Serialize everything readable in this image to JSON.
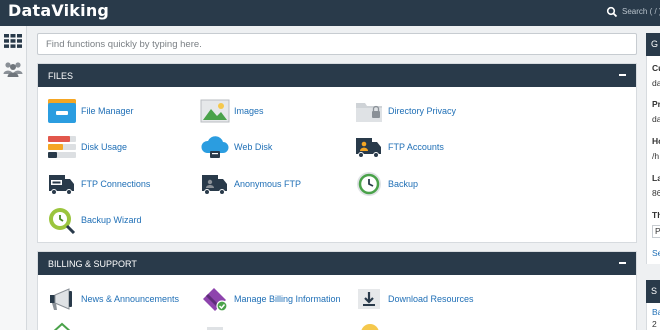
{
  "brand": "DataViking",
  "topbar": {
    "search_text": "Search ( / )"
  },
  "search": {
    "placeholder": "Find functions quickly by typing here."
  },
  "files": {
    "title": "FILES",
    "items": [
      {
        "label": "File Manager",
        "icon": "file-manager-icon"
      },
      {
        "label": "Images",
        "icon": "images-icon"
      },
      {
        "label": "Directory Privacy",
        "icon": "directory-privacy-icon"
      },
      {
        "label": "Disk Usage",
        "icon": "disk-usage-icon"
      },
      {
        "label": "Web Disk",
        "icon": "web-disk-icon"
      },
      {
        "label": "FTP Accounts",
        "icon": "ftp-accounts-icon"
      },
      {
        "label": "FTP Connections",
        "icon": "ftp-connections-icon"
      },
      {
        "label": "Anonymous FTP",
        "icon": "anonymous-ftp-icon"
      },
      {
        "label": "Backup",
        "icon": "backup-icon"
      },
      {
        "label": "Backup Wizard",
        "icon": "backup-wizard-icon"
      }
    ]
  },
  "billing": {
    "title": "BILLING & SUPPORT",
    "items": [
      {
        "label": "News & Announcements",
        "icon": "megaphone-icon"
      },
      {
        "label": "Manage Billing Information",
        "icon": "billing-card-icon"
      },
      {
        "label": "Download Resources",
        "icon": "download-icon"
      }
    ]
  },
  "right": {
    "head1": "G",
    "labels": [
      "Cu",
      "da",
      "Pr",
      "da",
      "Ho",
      "/h",
      "La",
      "86",
      "Th",
      "P",
      "Se"
    ],
    "head2": "S",
    "bottom": [
      "Ba",
      "2"
    ]
  },
  "colors": {
    "header": "#293a4a",
    "link": "#1f6fb6",
    "background": "#eef0f2"
  }
}
